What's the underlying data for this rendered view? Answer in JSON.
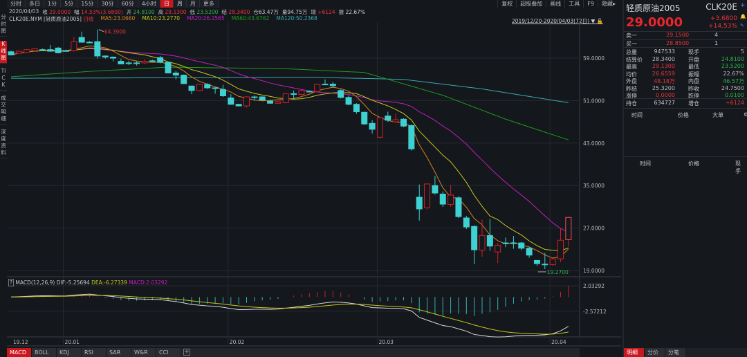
{
  "toolbar": {
    "tabs": [
      "分时",
      "多日",
      "1分",
      "5分",
      "15分",
      "30分",
      "60分",
      "4小时",
      "日",
      "周",
      "月",
      "更多"
    ],
    "active": "日",
    "right": [
      "复权",
      "超级叠加",
      "画线",
      "工具",
      "F9",
      "隐藏▸"
    ]
  },
  "left_tabs": [
    "分时图",
    "K线图",
    "TICK",
    "成交明细",
    "深度资料"
  ],
  "info": {
    "date": "2020/04/03",
    "close_label": "收",
    "close": "29.0000",
    "chg_label": "幅",
    "chg": "14.53%(3.6800)",
    "open_label": "开",
    "open": "24.8100",
    "high_label": "高",
    "high": "29.1300",
    "low_label": "低",
    "low": "23.5200",
    "settle_label": "结",
    "settle": "28.3400",
    "oi_label": "仓",
    "oi": "63.47万",
    "vol_label": "量",
    "vol": "94.75万",
    "inc_label": "增",
    "inc": "+6124",
    "amp_label": "振",
    "amp": "22.67%"
  },
  "legend": {
    "symbol": "CLK20E.NYM [轻质原油2005]",
    "period": "日线",
    "ma5": "MA5:23.0660",
    "ma10": "MA10:23.2770",
    "ma20": "MA20:26.2565",
    "ma60": "MA60:43.6762",
    "ma120": "MA120:50.2368"
  },
  "date_range": "2019/12/20-2020/04/03(72日)",
  "price_axis": [
    "59.0000",
    "51.0000",
    "43.0000",
    "35.0000",
    "27.0000",
    "19.0000"
  ],
  "macd_axis": [
    "2.03292",
    "-2.57212"
  ],
  "macd_legend": {
    "q": "?",
    "name": "MACD(12,26,9)",
    "dif": "DIF:-5.25694",
    "dea": "DEA:-6.27339",
    "macd": "MACD:2.03292"
  },
  "x_labels": [
    "19.12",
    "20.01",
    "20.02",
    "20.03",
    "20.04"
  ],
  "annotations": {
    "high": "64.3900",
    "low": "19.2700"
  },
  "indicator_tabs": [
    "MACD",
    "BOLL",
    "KDJ",
    "RSI",
    "SAR",
    "W&R",
    "CCI"
  ],
  "quote": {
    "name": "轻质原油2005",
    "code": "CLK20E",
    "price": "29.0000",
    "change": "+3.6800",
    "pct": "+14.53%",
    "ask_label": "卖一",
    "ask": "29.1500",
    "ask_vol": "4",
    "bid_label": "买一",
    "bid": "28.8500",
    "bid_vol": "1",
    "rows": [
      [
        "总量",
        "947533",
        "grey",
        "现手",
        "5",
        "grey"
      ],
      [
        "结算价",
        "28.3400",
        "grey",
        "开盘",
        "24.8100",
        "green"
      ],
      [
        "最高",
        "29.1300",
        "red",
        "最低",
        "23.5200",
        "green"
      ],
      [
        "均价",
        "26.6559",
        "red",
        "振幅",
        "22.67%",
        "grey"
      ],
      [
        "外盘",
        "48.18万",
        "red",
        "内盘",
        "46.57万",
        "green"
      ],
      [
        "昨结",
        "25.3200",
        "grey",
        "昨收",
        "24.7500",
        "grey"
      ],
      [
        "涨停",
        "0.0000",
        "red",
        "跌停",
        "0.0100",
        "green"
      ]
    ],
    "oi_label": "持仓",
    "oi": "634727",
    "inc_label": "增仓",
    "inc": "+6124",
    "tick_head": [
      "时间",
      "价格",
      "大单"
    ],
    "tick_head2": [
      "时间",
      "价格",
      "现手"
    ],
    "bottom_tabs": [
      "明细",
      "分价",
      "分笔"
    ]
  },
  "colors": {
    "up": "#d0202a",
    "down": "#3fd0d2",
    "ma5": "#d5831d",
    "ma10": "#c8c81e",
    "ma20": "#c21fc2",
    "ma60": "#1f9a1f",
    "ma120": "#3aa9ae"
  },
  "chart_data": {
    "type": "candlestick",
    "ylim": [
      19,
      59
    ],
    "candles_ohlc": [
      [
        60.2,
        60.4,
        59.5,
        59.6
      ],
      [
        59.9,
        60.4,
        59.8,
        60.3
      ],
      [
        60.1,
        60.7,
        60.0,
        60.6
      ],
      [
        60.4,
        60.9,
        60.3,
        60.8
      ],
      [
        60.6,
        60.8,
        60.5,
        60.6
      ],
      [
        60.6,
        61.5,
        60.2,
        60.3
      ],
      [
        60.9,
        61.1,
        59.9,
        60.0
      ],
      [
        60.4,
        60.6,
        60.2,
        60.4
      ],
      [
        60.4,
        63.0,
        60.2,
        62.1
      ],
      [
        62.9,
        64.0,
        61.9,
        62.0
      ],
      [
        62.0,
        62.2,
        61.8,
        62.0
      ],
      [
        62.1,
        64.39,
        58.9,
        59.4
      ],
      [
        59.4,
        59.5,
        58.9,
        59.2
      ],
      [
        59.2,
        59.3,
        58.4,
        59.0
      ],
      [
        58.4,
        58.9,
        57.9,
        57.9
      ],
      [
        58.1,
        58.5,
        57.7,
        58.1
      ],
      [
        58.1,
        58.4,
        57.6,
        58.1
      ],
      [
        58.1,
        58.8,
        57.9,
        58.4
      ],
      [
        58.5,
        58.7,
        58.3,
        58.5
      ],
      [
        59.1,
        59.4,
        58.0,
        58.2
      ],
      [
        58.2,
        58.3,
        56.1,
        56.2
      ],
      [
        56.2,
        56.6,
        55.0,
        55.8
      ],
      [
        55.8,
        55.9,
        54.1,
        54.2
      ],
      [
        53.75,
        53.8,
        52.2,
        52.9
      ],
      [
        52.9,
        54.1,
        52.8,
        54.05
      ],
      [
        54.05,
        54.3,
        53.2,
        53.4
      ],
      [
        53.4,
        53.5,
        52.3,
        53.4
      ],
      [
        53.1,
        54.0,
        51.7,
        51.9
      ],
      [
        51.5,
        52.2,
        50.2,
        50.3
      ],
      [
        50.3,
        50.4,
        49.9,
        50.0
      ],
      [
        50.0,
        51.8,
        49.7,
        51.7
      ],
      [
        51.7,
        52.0,
        51.0,
        51.7
      ],
      [
        51.7,
        51.8,
        51.0,
        51.1
      ],
      [
        50.9,
        51.2,
        50.4,
        50.5
      ],
      [
        50.5,
        50.9,
        50.4,
        50.8
      ],
      [
        50.6,
        52.4,
        50.5,
        52.3
      ],
      [
        52.3,
        52.9,
        51.3,
        52.3
      ],
      [
        52.15,
        53.0,
        52.0,
        52.9
      ],
      [
        52.75,
        52.9,
        52.6,
        52.75
      ],
      [
        52.7,
        54.1,
        52.6,
        54.05
      ],
      [
        54.1,
        55.0,
        54.0,
        54.1
      ],
      [
        54.1,
        54.5,
        53.4,
        53.8
      ],
      [
        52.9,
        53.2,
        51.4,
        51.6
      ],
      [
        51.6,
        52.0,
        50.1,
        50.3
      ],
      [
        50.3,
        50.5,
        48.5,
        48.9
      ],
      [
        48.8,
        48.9,
        46.4,
        46.6
      ],
      [
        46.7,
        47.3,
        44.8,
        45.6
      ],
      [
        44.1,
        47.8,
        43.8,
        47.8
      ],
      [
        48.1,
        48.9,
        47.0,
        47.3
      ],
      [
        47.0,
        48.6,
        46.9,
        47.4
      ],
      [
        47.5,
        47.7,
        46.0,
        46.2
      ],
      [
        46.3,
        46.5,
        41.6,
        41.9
      ],
      [
        32.8,
        35.2,
        28.4,
        30.6
      ],
      [
        30.8,
        35.3,
        30.5,
        35.3
      ],
      [
        35.0,
        36.8,
        33.3,
        33.6
      ],
      [
        33.4,
        33.9,
        31.0,
        31.5
      ],
      [
        31.45,
        35.1,
        31.0,
        33.2
      ],
      [
        32.7,
        33.0,
        28.9,
        29.15
      ],
      [
        28.9,
        29.3,
        26.8,
        27.2
      ],
      [
        27.3,
        27.5,
        20.2,
        22.9
      ],
      [
        22.85,
        28.6,
        21.6,
        25.6
      ],
      [
        25.6,
        28.7,
        22.7,
        23.6
      ],
      [
        22.5,
        24.2,
        20.4,
        23.75
      ],
      [
        24.2,
        25.2,
        23.4,
        24.2
      ],
      [
        24.2,
        25.5,
        23.1,
        24.2
      ],
      [
        24.2,
        24.4,
        22.8,
        23.2
      ],
      [
        23.2,
        23.4,
        21.4,
        21.9
      ],
      [
        20.9,
        20.9,
        19.9,
        20.3
      ],
      [
        20.2,
        22.3,
        19.27,
        20.1
      ],
      [
        20.1,
        21.3,
        19.9,
        21.2
      ],
      [
        21.2,
        26.9,
        20.6,
        24.7
      ],
      [
        24.81,
        29.13,
        23.52,
        29.0
      ]
    ],
    "ma60_points": [
      [
        0,
        55.5
      ],
      [
        10,
        56.5
      ],
      [
        20,
        57.3
      ],
      [
        35,
        57.0
      ],
      [
        45,
        56.3
      ],
      [
        55,
        52.0
      ],
      [
        63,
        47.5
      ],
      [
        71,
        43.6
      ]
    ],
    "ma120_points": [
      [
        0,
        55.2
      ],
      [
        20,
        55.3
      ],
      [
        38,
        55.4
      ],
      [
        50,
        55.0
      ],
      [
        60,
        53.2
      ],
      [
        71,
        50.6
      ]
    ],
    "x_label_bars": [
      0,
      7,
      28,
      47,
      69
    ],
    "macd_ylim": [
      -7.2,
      2.6
    ]
  }
}
